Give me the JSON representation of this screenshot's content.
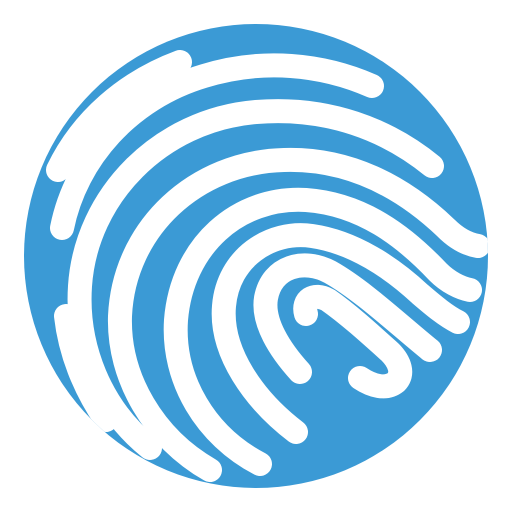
{
  "icon": {
    "name": "fingerprint-icon",
    "shape": "circle",
    "colors": {
      "fill": "#3B9AD5",
      "ridges": "#FFFFFF",
      "background": "#FFFFFF"
    }
  }
}
